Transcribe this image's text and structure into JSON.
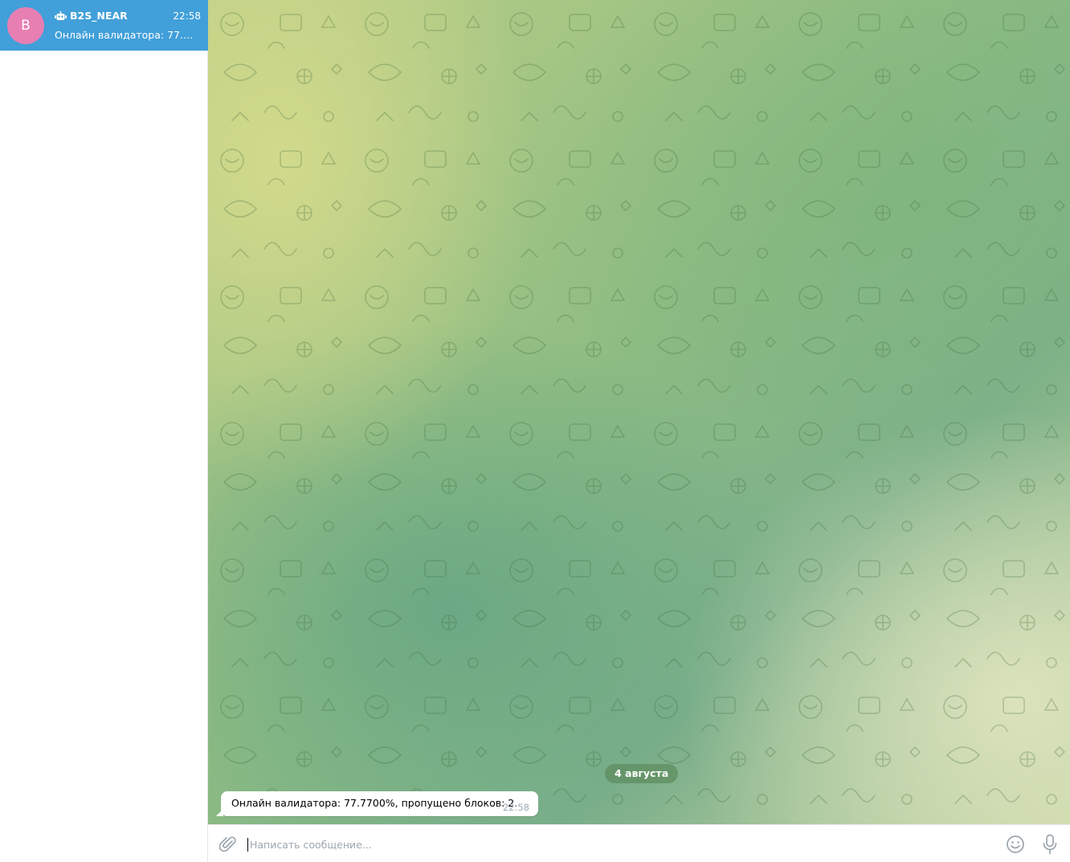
{
  "sidebar": {
    "chats": [
      {
        "avatar_letter": "B",
        "avatar_color": "#e77fb3",
        "icon": "bot-icon",
        "name": "B2S_NEAR",
        "time": "22:58",
        "preview": "Онлайн валидатора: 77.770...",
        "selected": true
      }
    ],
    "selected_color": "#419fd9"
  },
  "chat": {
    "date_badge": "4 августа",
    "messages": [
      {
        "text": "Онлайн валидатора: 77.7700%, пропущено блоков: 2.",
        "time": "22:58"
      }
    ]
  },
  "composer": {
    "placeholder": "Написать сообщение...",
    "value": "",
    "attach_icon": "paperclip-icon",
    "emoji_icon": "smile-icon",
    "mic_icon": "microphone-icon"
  }
}
